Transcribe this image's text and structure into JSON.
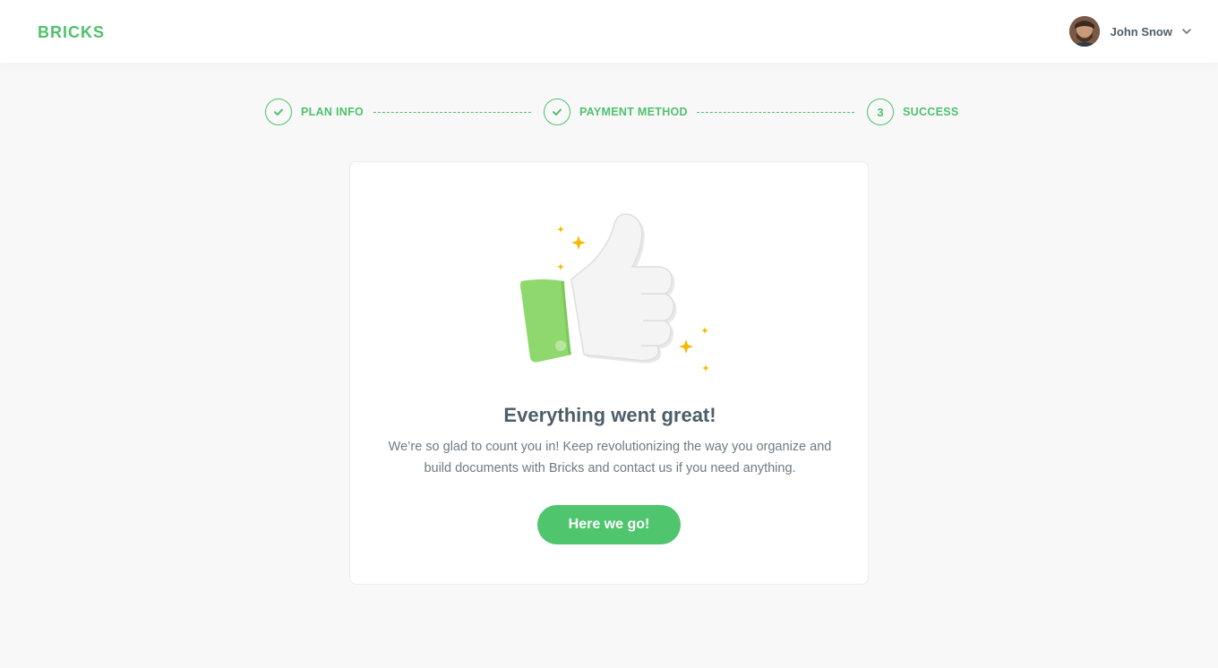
{
  "header": {
    "logo": "BRICKS",
    "user": {
      "name": "John Snow"
    }
  },
  "stepper": {
    "steps": [
      {
        "label": "PLAN INFO",
        "status": "complete",
        "marker": "check"
      },
      {
        "label": "PAYMENT METHOD",
        "status": "complete",
        "marker": "check"
      },
      {
        "label": "SUCCESS",
        "status": "current",
        "number": "3"
      }
    ]
  },
  "card": {
    "title": "Everything went great!",
    "body": "We’re so glad to count you in! Keep revolutionizing the way you organize and build documents with Bricks and contact us if you need anything.",
    "button_label": "Here we go!",
    "illustration": "thumbs-up-with-sparkles"
  },
  "colors": {
    "accent": "#4fc16d",
    "button": "#4fc56e",
    "sparkle": "#f5b800",
    "sleeve": "#8fd86d",
    "background": "#f8f8f8"
  }
}
